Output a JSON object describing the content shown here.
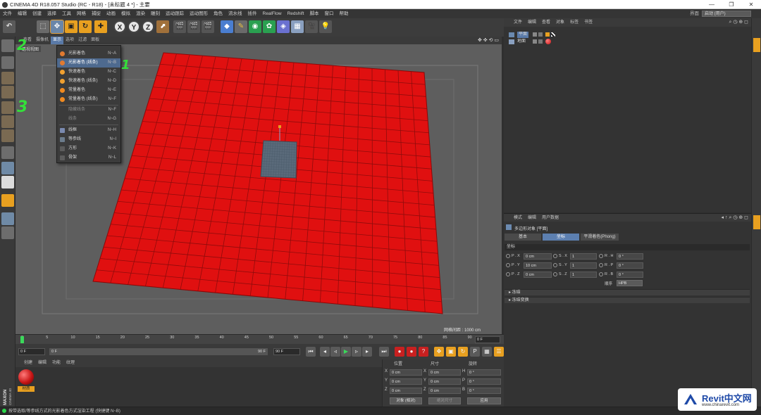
{
  "window": {
    "title": "CINEMA 4D R18.057 Studio (RC - R18) - [未标题 4 *] - 主要",
    "controls": [
      "—",
      "❐",
      "✕"
    ]
  },
  "menubar": {
    "items": [
      "文件",
      "编辑",
      "创建",
      "选择",
      "工具",
      "网格",
      "捕捉",
      "动画",
      "模拟",
      "渲染",
      "雕刻",
      "运动跟踪",
      "运动图形",
      "角色",
      "流水线",
      "插件",
      "RealFlow",
      "Redshift",
      "脚本",
      "窗口",
      "帮助"
    ],
    "layout_label": "界面",
    "layout_value": "启动 (用户)"
  },
  "viewport": {
    "menu": [
      "查看",
      "摄像机",
      "显示",
      "选项",
      "过滤",
      "面板"
    ],
    "active_menu": "显示",
    "label": "透视视图",
    "grid_info": "网格间距 : 1000 cm"
  },
  "display_menu": {
    "items": [
      {
        "label": "光影着色",
        "key": "N~A"
      },
      {
        "label": "光影着色 (线条)",
        "key": "N~B"
      },
      {
        "label": "快速着色",
        "key": "N~C"
      },
      {
        "label": "快速着色 (线条)",
        "key": "N~D"
      },
      {
        "label": "常量着色",
        "key": "N~E"
      },
      {
        "label": "常量着色 (线条)",
        "key": "N~F"
      },
      {
        "label": "隐藏线条",
        "key": "N~F"
      },
      {
        "label": "线条",
        "key": "N~G"
      },
      {
        "label": "线框",
        "key": "N~H"
      },
      {
        "label": "等参线",
        "key": "N~I"
      },
      {
        "label": "方形",
        "key": "N~K"
      },
      {
        "label": "骨架",
        "key": "N~L"
      }
    ]
  },
  "annotations": [
    "2",
    "1",
    "3"
  ],
  "timeline": {
    "ticks": [
      "0",
      "5",
      "10",
      "15",
      "20",
      "25",
      "30",
      "35",
      "40",
      "45",
      "50",
      "55",
      "60",
      "65",
      "70",
      "75",
      "80",
      "85",
      "90"
    ],
    "current_frame": "0 F",
    "start": "0 F",
    "slider_start": "0 F",
    "slider_end": "90 F",
    "end": "90 F"
  },
  "material_manager": {
    "menu": [
      "创建",
      "编辑",
      "功能",
      "纹理"
    ],
    "material_name": "材质"
  },
  "coordinates": {
    "headers": [
      "位置",
      "尺寸",
      "旋转"
    ],
    "rows": [
      {
        "axis": "X",
        "pos": "0 cm",
        "size_axis": "X",
        "size": "0 cm",
        "rot_axis": "H",
        "rot": "0 °"
      },
      {
        "axis": "Y",
        "pos": "0 cm",
        "size_axis": "Y",
        "size": "0 cm",
        "rot_axis": "P",
        "rot": "0 °"
      },
      {
        "axis": "Z",
        "pos": "0 cm",
        "size_axis": "Z",
        "size": "0 cm",
        "rot_axis": "B",
        "rot": "0 °"
      }
    ],
    "mode": "对象 (相对)",
    "size_mode": "绝对尺寸",
    "apply": "应用"
  },
  "object_manager": {
    "menu": [
      "文件",
      "编辑",
      "查看",
      "对象",
      "标签",
      "书签"
    ],
    "objects": [
      "平面",
      "地面"
    ]
  },
  "attribute_manager": {
    "menu": [
      "模式",
      "编辑",
      "用户数据"
    ],
    "title": "多边形对象 [平面]",
    "tabs": [
      "基本",
      "坐标",
      "平滑着色(Phong)"
    ],
    "active_tab": "坐标",
    "section": "坐标",
    "fields": [
      {
        "p_lbl": "P . X",
        "p_val": "0 cm",
        "s_lbl": "S . X",
        "s_val": "1",
        "r_lbl": "R . H",
        "r_val": "0 °"
      },
      {
        "p_lbl": "P . Y",
        "p_val": "10 cm",
        "s_lbl": "S . Y",
        "s_val": "1",
        "r_lbl": "R . P",
        "r_val": "0 °"
      },
      {
        "p_lbl": "P . Z",
        "p_val": "0 cm",
        "s_lbl": "S . Z",
        "s_val": "1",
        "r_lbl": "R . B",
        "r_val": "0 °"
      }
    ],
    "order_label": "顺序",
    "order_value": "HPB",
    "collapsed": [
      "▸ 冻结",
      "▸ 冻结变换"
    ]
  },
  "status": {
    "text": "按带选取/等参线方式的光影着色方式渲染工程 (快捷键 N~B)"
  },
  "watermark": {
    "title": "Revit中文网",
    "url": "www.chinarevit.com"
  },
  "colors": {
    "plane_red": "#e01010",
    "selection_blue": "#4e6a8f",
    "annotation_green": "#34e03a"
  }
}
